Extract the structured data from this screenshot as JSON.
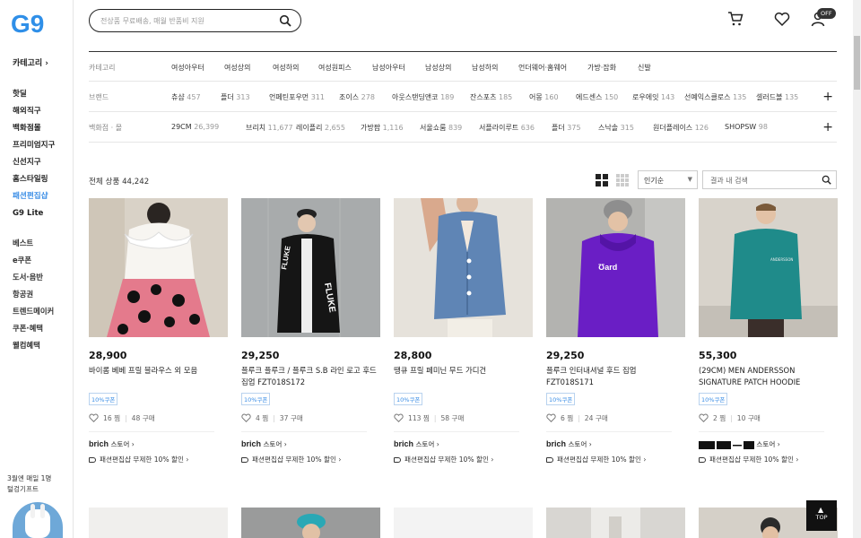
{
  "header": {
    "search_placeholder": "전상품 무료배송, 매월 반품비 지원",
    "off_badge": "OFF"
  },
  "leftnav": {
    "category_label": "카테고리 ›",
    "main_items": [
      "핫딜",
      "해외직구",
      "백화점몰",
      "프리미엄지구",
      "신선지구",
      "홈스타일링",
      "패션편집샵",
      "G9 Lite"
    ],
    "active_index": 6,
    "sub_items": [
      "베스트",
      "e쿠폰",
      "도서·음반",
      "항공권",
      "트렌드메이커",
      "쿠폰·혜택",
      "웰컴혜택"
    ],
    "promo_line1": "3월엔 매일 1명",
    "promo_line2": "털겅기프트"
  },
  "filters": [
    {
      "label": "카테고리",
      "items": [
        {
          "name": "여성아우터",
          "count": ""
        },
        {
          "name": "여성상의",
          "count": ""
        },
        {
          "name": "여성하의",
          "count": ""
        },
        {
          "name": "여성원피스",
          "count": ""
        },
        {
          "name": "남성아우터",
          "count": ""
        },
        {
          "name": "남성상의",
          "count": ""
        },
        {
          "name": "남성하의",
          "count": ""
        },
        {
          "name": "언더웨어·홈웨어",
          "count": ""
        },
        {
          "name": "가방·잡화",
          "count": ""
        },
        {
          "name": "신발",
          "count": ""
        }
      ],
      "plus": false
    },
    {
      "label": "브랜드",
      "items": [
        {
          "name": "츄샵",
          "count": "457"
        },
        {
          "name": "플더",
          "count": "313"
        },
        {
          "name": "언페틴포우먼",
          "count": "311"
        },
        {
          "name": "조이스",
          "count": "278"
        },
        {
          "name": "아웃스탠딩앤코",
          "count": "189"
        },
        {
          "name": "잔스포츠",
          "count": "185"
        },
        {
          "name": "어몽",
          "count": "160"
        },
        {
          "name": "에드센스",
          "count": "150"
        },
        {
          "name": "로우에잇",
          "count": "143"
        },
        {
          "name": "선예익스클로스",
          "count": "135"
        },
        {
          "name": "셀러드볼",
          "count": "135"
        }
      ],
      "plus": true
    },
    {
      "label": "백화점 · 몰",
      "items": [
        {
          "name": "29CM",
          "count": "26,399"
        },
        {
          "name": "브리치",
          "count": "11,677"
        },
        {
          "name": "레이플리",
          "count": "2,655"
        },
        {
          "name": "가방팝",
          "count": "1,116"
        },
        {
          "name": "서울쇼룸",
          "count": "839"
        },
        {
          "name": "서플라이루트",
          "count": "636"
        },
        {
          "name": "플더",
          "count": "375"
        },
        {
          "name": "스낙솔",
          "count": "315"
        },
        {
          "name": "원더플레이스",
          "count": "126"
        },
        {
          "name": "SHOPSW",
          "count": "98"
        }
      ],
      "plus": true
    }
  ],
  "toolbar": {
    "total_label": "전체 상품",
    "total_count": "44,242",
    "sort_value": "인기순",
    "inner_search_placeholder": "결과 내 검색"
  },
  "products": [
    {
      "price": "28,900",
      "name": "바이롬 베베 프릴 블라우스 외 모음",
      "coupon": "10%쿠폰",
      "likes": "16 찜",
      "sold": "48 구매",
      "store": "brich",
      "store_suffix": "스토어 ›",
      "discount": "패션편집샵 무제한 10% 할인 ›"
    },
    {
      "price": "29,250",
      "name": "플루크 플루크 / 플루크 S.B 라인 로고 후드 집업 FZT018S172",
      "coupon": "10%쿠폰",
      "likes": "4 찜",
      "sold": "37 구매",
      "store": "brich",
      "store_suffix": "스토어 ›",
      "discount": "패션편집샵 무제한 10% 할인 ›"
    },
    {
      "price": "28,800",
      "name": "땡큐 프릴 페미닌 무드 가디건",
      "coupon": "10%쿠폰",
      "likes": "113 찜",
      "sold": "58 구매",
      "store": "brich",
      "store_suffix": "스토어 ›",
      "discount": "패션편집샵 무제한 10% 할인 ›"
    },
    {
      "price": "29,250",
      "name": "플루크 인터내셔널 후드 집업 FZT018S171",
      "coupon": "10%쿠폰",
      "likes": "6 찜",
      "sold": "24 구매",
      "store": "brich",
      "store_suffix": "스토어 ›",
      "discount": "패션편집샵 무제한 10% 할인 ›"
    },
    {
      "price": "55,300",
      "name": "(29CM) MEN ANDERSSON SIGNATURE PATCH HOODIE atb230u(Blue …",
      "coupon": "10%쿠폰",
      "likes": "2 찜",
      "sold": "10 구매",
      "store": "",
      "store_suffix": "스토어 ›",
      "discount": "패션편집샵 무제한 10% 할인 ›"
    }
  ],
  "top_button": "TOP"
}
